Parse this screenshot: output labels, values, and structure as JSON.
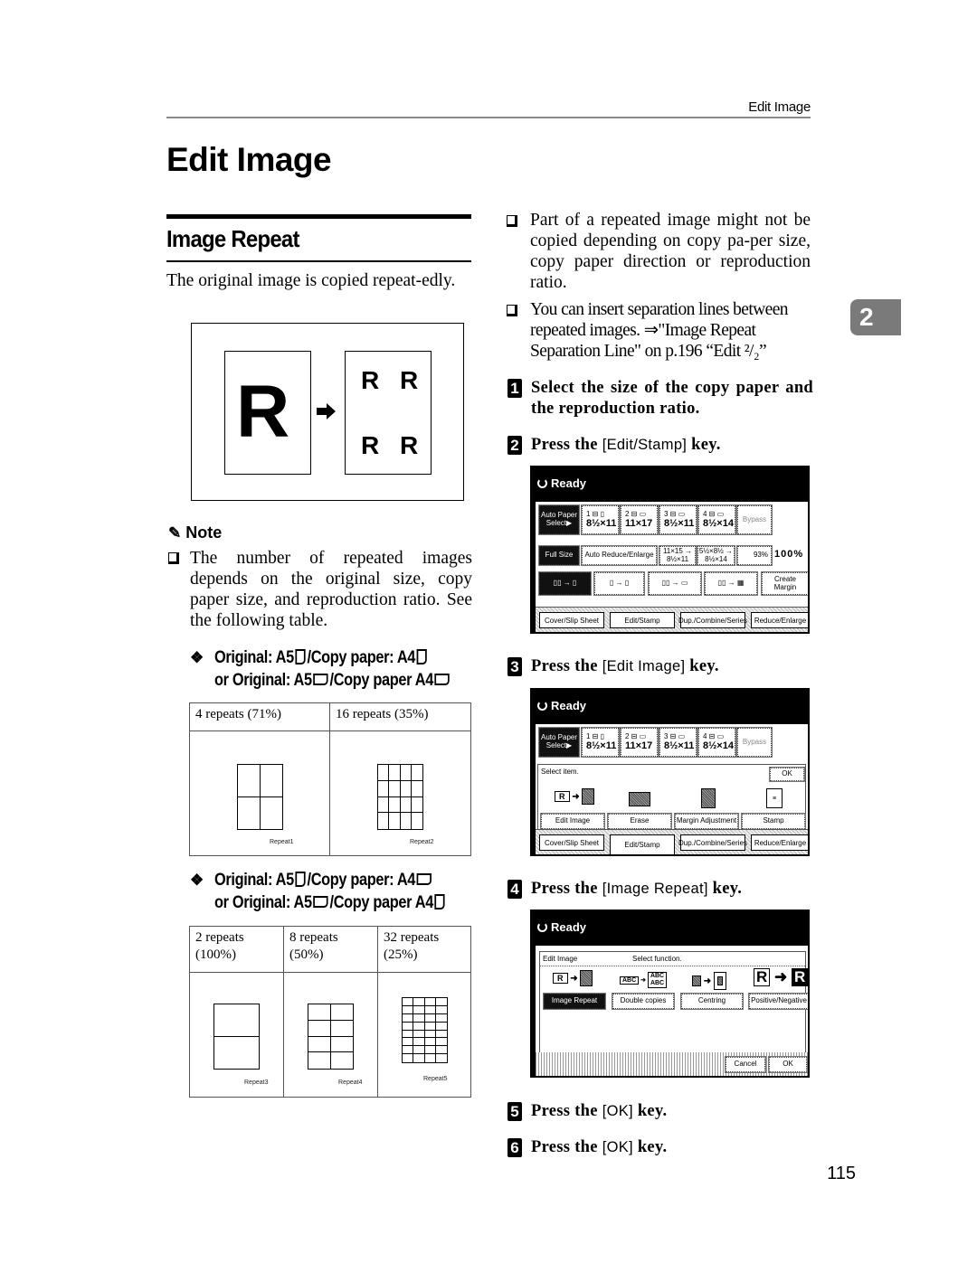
{
  "header": {
    "running_head": "Edit Image",
    "page_title": "Edit Image"
  },
  "section": {
    "title": "Image Repeat",
    "intro": "The original image is copied repeat-edly.",
    "illustration": {
      "original_letter": "R",
      "copy_letters": [
        "R",
        "R",
        "R",
        "R"
      ]
    }
  },
  "note": {
    "heading": "Note",
    "items": [
      "The number of repeated images depends on the original size, copy paper size, and reproduction ratio. See the following table."
    ]
  },
  "table1": {
    "heading_line1_a": "Original: A5",
    "heading_line1_b": "/Copy paper: A4",
    "heading_line2_a": "or Original: A5",
    "heading_line2_b": "/Copy paper A4",
    "cells": [
      {
        "label": "4 repeats (71%)",
        "caption": "Repeat1",
        "cols": 2,
        "rows": 2
      },
      {
        "label": "16 repeats (35%)",
        "caption": "Repeat2",
        "cols": 4,
        "rows": 4
      }
    ]
  },
  "table2": {
    "heading_line1_a": "Original: A5",
    "heading_line1_b": "/Copy paper: A4",
    "heading_line2_a": "or Original: A5",
    "heading_line2_b": "/Copy paper A4",
    "cells": [
      {
        "label1": "2 repeats",
        "label2": "(100%)",
        "caption": "Repeat3",
        "cols": 1,
        "rows": 2
      },
      {
        "label1": "8 repeats",
        "label2": "(50%)",
        "caption": "Repeat4",
        "cols": 2,
        "rows": 4
      },
      {
        "label1": "32 repeats",
        "label2": "(25%)",
        "caption": "Repeat5",
        "cols": 4,
        "rows": 8
      }
    ]
  },
  "right_notes": [
    "Part of a repeated image might not be copied depending on copy pa-per size, copy paper direction or reproduction ratio.",
    "You can insert separation lines between repeated images. ⇒\"Image Repeat Separation Line\" on p.196 “Edit ²/₂”"
  ],
  "chapter_tab": "2",
  "steps": [
    {
      "num": "1",
      "text": "Select the size of the copy paper and the reproduction ratio."
    },
    {
      "num": "2",
      "pre": "Press the ",
      "key": "[Edit/Stamp]",
      "post": " key."
    },
    {
      "num": "3",
      "pre": "Press the ",
      "key": "[Edit Image]",
      "post": " key."
    },
    {
      "num": "4",
      "pre": "Press the ",
      "key": "[Image Repeat]",
      "post": " key."
    },
    {
      "num": "5",
      "pre": "Press the ",
      "key": "[OK]",
      "post": " key."
    },
    {
      "num": "6",
      "pre": "Press the ",
      "key": "[OK]",
      "post": " key."
    }
  ],
  "screen_common": {
    "status": "Ready",
    "auto_paper": "Auto Paper Select▶",
    "trays": [
      {
        "t1": "1 ⊟ ▯",
        "t2": "8½×11"
      },
      {
        "t1": "2 ⊟ ▭",
        "t2": "11×17"
      },
      {
        "t1": "3 ⊟ ▭",
        "t2": "8½×11"
      },
      {
        "t1": "4 ⊟ ▭",
        "t2": "8½×14"
      }
    ],
    "bypass": "Bypass",
    "tabs": [
      "Cover/Slip Sheet",
      "Edit/Stamp",
      "Dup./Combine/Series",
      "Reduce/Enlarge"
    ]
  },
  "screen1": {
    "full_size": "Full Size",
    "auto_reduce": "Auto Reduce/Enlarge",
    "preset1": "11×15 → 8½×11",
    "preset2": "5½×8½ → 8½×14",
    "ratio_btn": "93%",
    "ratio_value": "100%",
    "create_margin": "Create Margin"
  },
  "screen2": {
    "prompt": "Select item.",
    "ok": "OK",
    "items": [
      "Edit Image",
      "Erase",
      "Margin Adjustment",
      "Stamp"
    ]
  },
  "screen3": {
    "title": "Edit Image",
    "prompt": "Select function.",
    "items": [
      "Image Repeat",
      "Double copies",
      "Centring",
      "Positive/Negative"
    ],
    "cancel": "Cancel",
    "ok": "OK"
  },
  "page_number": "115"
}
